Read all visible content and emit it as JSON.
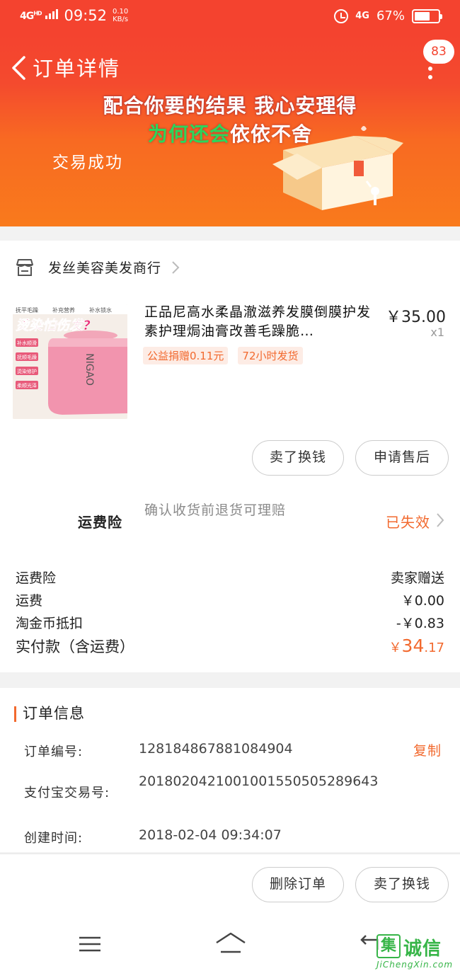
{
  "status_bar": {
    "network": "4G",
    "network_sup": "HD",
    "time": "09:52",
    "speed": "0.10",
    "speed_unit": "KB/s",
    "network_right": "4G",
    "battery": "67%",
    "battery_level": 0.67
  },
  "header": {
    "title": "订单详情",
    "badge_count": "83",
    "lyric_line1": "配合你要的结果 我心安理得",
    "lyric_line2_highlight": "为何还会",
    "lyric_line2_rest": "依依不舍",
    "order_status": "交易成功",
    "colors": {
      "top": "#f4432f",
      "bottom": "#f97a1c",
      "accent": "#f2692e"
    }
  },
  "shop": {
    "name": "发丝美容美发商行",
    "icon": "store-icon"
  },
  "product": {
    "title": "正品尼高水柔晶澈滋养发膜倒膜护发素护理焗油膏改善毛躁脆…",
    "price": "￥35.00",
    "quantity": "x1",
    "tags": [
      "公益捐赠0.11元",
      "72小时发货"
    ],
    "image": {
      "banner_text": "烫染怕伤发?",
      "top_labels": [
        "抚平毛躁",
        "补充营养",
        "补水锁水"
      ],
      "side_labels": [
        "补水顺滑",
        "抚顺毛躁",
        "烫染修护",
        "柔顺光泽"
      ],
      "brand": "NIGAO"
    }
  },
  "actions": {
    "resell": "卖了换钱",
    "after_sale": "申请售后"
  },
  "insurance": {
    "label": "运费险",
    "description": "确认收货前退货可理赔",
    "status": "已失效"
  },
  "fees": [
    {
      "label": "运费险",
      "value": "卖家赠送"
    },
    {
      "label": "运费",
      "value": "￥0.00"
    },
    {
      "label": "淘金币抵扣",
      "value": "-￥0.83"
    }
  ],
  "total": {
    "label": "实付款（含运费）",
    "currency": "￥",
    "integer": "34",
    "decimal": ".17"
  },
  "order_info": {
    "title": "订单信息",
    "rows": [
      {
        "label": "订单编号:",
        "value": "128184867881084904"
      },
      {
        "label": "支付宝交易号:",
        "value": "2018020421001001550505289643"
      },
      {
        "label": "创建时间:",
        "value": "2018-02-04 09:34:07"
      }
    ],
    "copy_label": "复制"
  },
  "bottom_actions": {
    "delete": "删除订单",
    "resell": "卖了换钱"
  },
  "watermark": {
    "logo": "集",
    "text": "诚信",
    "url": "JiChengXin.com"
  }
}
